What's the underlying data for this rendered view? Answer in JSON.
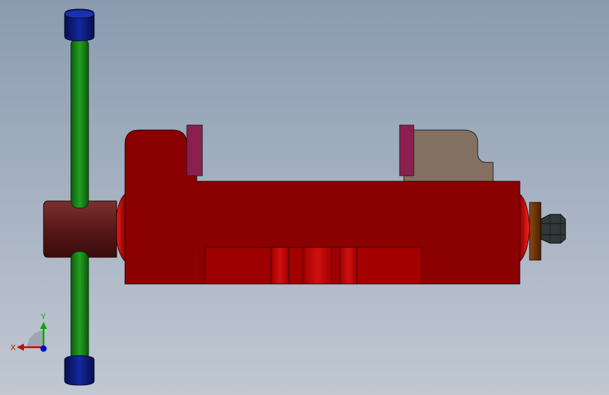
{
  "scene": {
    "colors": {
      "background_top": "#8a9bb0",
      "background_bottom": "#c1c8d2",
      "vise_body": "#8b0000",
      "vise_body_highlight": "#c41010",
      "jaw_plate": "#8b2050",
      "movable_jaw": "#847060",
      "handle_rod": "#1a8a1a",
      "handle_cap": "#0a1a80",
      "screw_sleeve": "#5a1818",
      "washer": "#6b3008",
      "nut": "#303838"
    },
    "parts": [
      "vise-body",
      "fixed-jaw-plate",
      "movable-jaw",
      "movable-jaw-plate",
      "handle-rod",
      "handle-cap-top",
      "handle-cap-bottom",
      "screw-sleeve",
      "washer",
      "hex-nut"
    ]
  },
  "triad": {
    "x_label": "X",
    "y_label": "Y",
    "colors": {
      "x": "#cc0000",
      "y": "#00aa00",
      "z": "#0000cc"
    }
  }
}
